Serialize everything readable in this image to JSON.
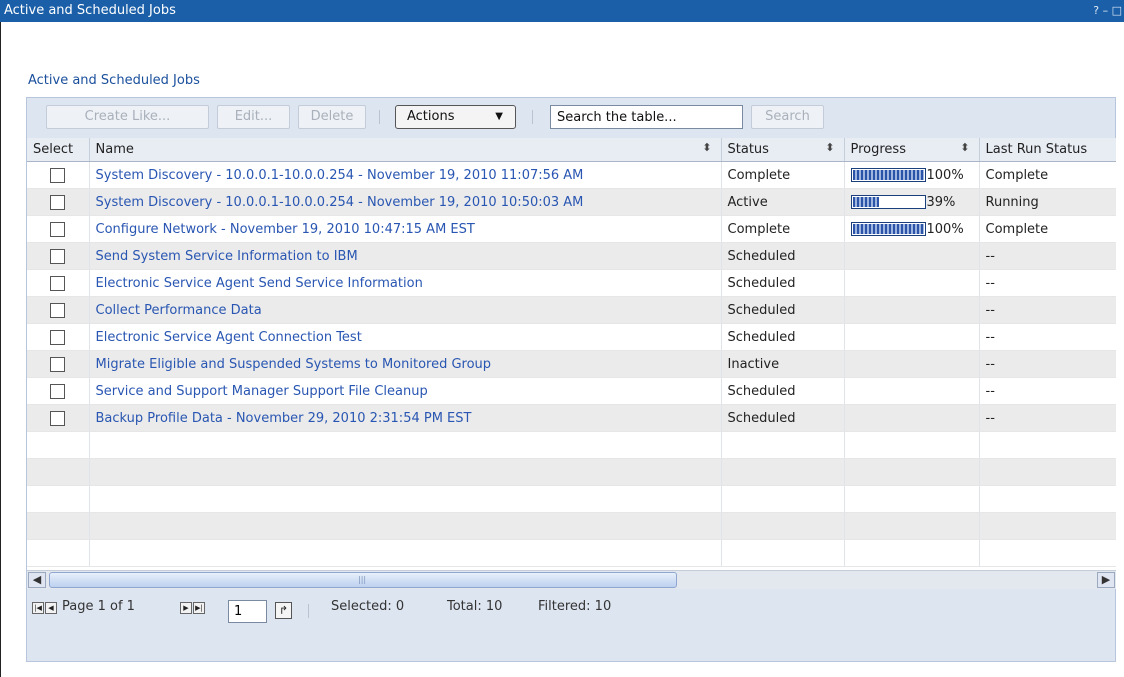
{
  "window": {
    "title": "Active and Scheduled Jobs",
    "controls": "? – □"
  },
  "section_title": "Active and Scheduled Jobs",
  "toolbar": {
    "create_like": "Create Like...",
    "edit": "Edit...",
    "delete": "Delete",
    "actions": "Actions",
    "search_placeholder": "Search the table...",
    "search_button": "Search"
  },
  "columns": {
    "select": "Select",
    "name": "Name",
    "status": "Status",
    "progress": "Progress",
    "last_run_status": "Last Run Status"
  },
  "rows": [
    {
      "name": "System Discovery - 10.0.0.1-10.0.0.254 - November 19, 2010 11:07:56 AM",
      "status": "Complete",
      "progress": 1.0,
      "progress_text": "100%",
      "last_run_status": "Complete"
    },
    {
      "name": "System Discovery - 10.0.0.1-10.0.0.254 - November 19, 2010 10:50:03 AM",
      "status": "Active",
      "progress": 0.39,
      "progress_text": "39%",
      "last_run_status": "Running"
    },
    {
      "name": "Configure Network - November 19, 2010 10:47:15 AM EST",
      "status": "Complete",
      "progress": 1.0,
      "progress_text": "100%",
      "last_run_status": "Complete"
    },
    {
      "name": "Send System Service Information to IBM",
      "status": "Scheduled",
      "progress": null,
      "progress_text": "",
      "last_run_status": "--"
    },
    {
      "name": "Electronic Service Agent Send Service Information",
      "status": "Scheduled",
      "progress": null,
      "progress_text": "",
      "last_run_status": "--"
    },
    {
      "name": "Collect Performance Data",
      "status": "Scheduled",
      "progress": null,
      "progress_text": "",
      "last_run_status": "--"
    },
    {
      "name": "Electronic Service Agent Connection Test",
      "status": "Scheduled",
      "progress": null,
      "progress_text": "",
      "last_run_status": "--"
    },
    {
      "name": "Migrate Eligible and Suspended Systems to Monitored Group",
      "status": "Inactive",
      "progress": null,
      "progress_text": "",
      "last_run_status": "--"
    },
    {
      "name": "Service and Support Manager Support File Cleanup",
      "status": "Scheduled",
      "progress": null,
      "progress_text": "",
      "last_run_status": "--"
    },
    {
      "name": "Backup Profile Data - November 29, 2010 2:31:54 PM EST",
      "status": "Scheduled",
      "progress": null,
      "progress_text": "",
      "last_run_status": "--"
    }
  ],
  "footer": {
    "page_label": "Page 1 of 1",
    "page_value": "1",
    "selected": "Selected: 0",
    "total": "Total: 10",
    "filtered": "Filtered: 10"
  },
  "colors": {
    "title_bar": "#1a5fa8",
    "link": "#2956b2",
    "panel": "#dde5f1"
  },
  "icons": {
    "first": "first-page-icon",
    "prev": "prev-page-icon",
    "next": "next-page-icon",
    "last": "last-page-icon",
    "go": "go-arrow-icon",
    "sort": "sort-icon",
    "dropdown": "dropdown-arrow-icon"
  }
}
